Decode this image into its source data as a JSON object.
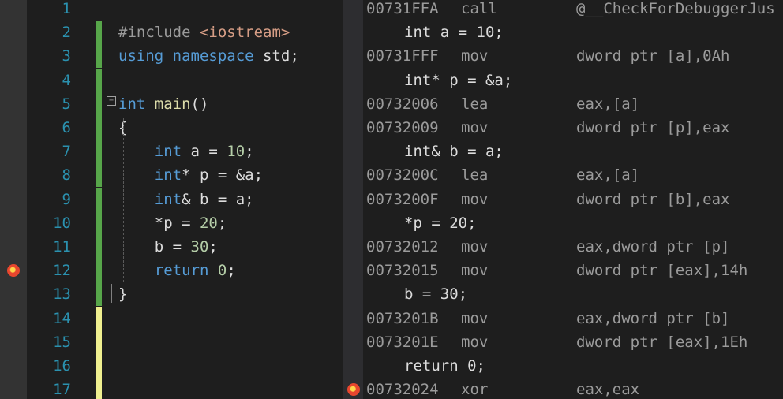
{
  "editor": {
    "lines": [
      {
        "n": "1",
        "tokens": []
      },
      {
        "n": "2",
        "tokens": [
          [
            "pp",
            "#include "
          ],
          [
            "str",
            "<iostream>"
          ]
        ]
      },
      {
        "n": "3",
        "tokens": [
          [
            "kw",
            "using"
          ],
          [
            "t",
            " "
          ],
          [
            "kw",
            "namespace"
          ],
          [
            "t",
            " std;"
          ]
        ]
      },
      {
        "n": "4",
        "tokens": []
      },
      {
        "n": "5",
        "tokens": [
          [
            "kw",
            "int"
          ],
          [
            "t",
            " "
          ],
          [
            "fn",
            "main"
          ],
          [
            "t",
            "()"
          ]
        ]
      },
      {
        "n": "6",
        "tokens": [
          [
            "t",
            "{"
          ]
        ]
      },
      {
        "n": "7",
        "tokens": [
          [
            "t",
            "    "
          ],
          [
            "kw",
            "int"
          ],
          [
            "t",
            " a = "
          ],
          [
            "num",
            "10"
          ],
          [
            "t",
            ";"
          ]
        ]
      },
      {
        "n": "8",
        "tokens": [
          [
            "t",
            "    "
          ],
          [
            "kw",
            "int"
          ],
          [
            "t",
            "* p = &a;"
          ]
        ]
      },
      {
        "n": "9",
        "tokens": [
          [
            "t",
            "    "
          ],
          [
            "kw",
            "int"
          ],
          [
            "t",
            "& b = a;"
          ]
        ]
      },
      {
        "n": "10",
        "tokens": [
          [
            "t",
            "    *p = "
          ],
          [
            "num",
            "20"
          ],
          [
            "t",
            ";"
          ]
        ]
      },
      {
        "n": "11",
        "tokens": [
          [
            "t",
            "    b = "
          ],
          [
            "num",
            "30"
          ],
          [
            "t",
            ";"
          ]
        ]
      },
      {
        "n": "12",
        "tokens": [
          [
            "t",
            "    "
          ],
          [
            "kw",
            "return"
          ],
          [
            "t",
            " "
          ],
          [
            "num",
            "0"
          ],
          [
            "t",
            ";"
          ]
        ]
      },
      {
        "n": "13",
        "tokens": [
          [
            "t",
            "}"
          ]
        ]
      },
      {
        "n": "14",
        "tokens": []
      },
      {
        "n": "15",
        "tokens": []
      },
      {
        "n": "16",
        "tokens": []
      },
      {
        "n": "17",
        "tokens": []
      }
    ],
    "breakpoint_line": "12",
    "collapse_glyph": "−"
  },
  "disassembly": {
    "rows": [
      {
        "addr": "00731FFA",
        "mnemonic": "call",
        "operands": "@__CheckForDebuggerJus"
      },
      {
        "src": "int a = 10;"
      },
      {
        "addr": "00731FFF",
        "mnemonic": "mov",
        "operands": "dword ptr [a],0Ah"
      },
      {
        "src": "int* p = &a;"
      },
      {
        "addr": "00732006",
        "mnemonic": "lea",
        "operands": "eax,[a]"
      },
      {
        "addr": "00732009",
        "mnemonic": "mov",
        "operands": "dword ptr [p],eax"
      },
      {
        "src": "int& b = a;"
      },
      {
        "addr": "0073200C",
        "mnemonic": "lea",
        "operands": "eax,[a]"
      },
      {
        "addr": "0073200F",
        "mnemonic": "mov",
        "operands": "dword ptr [b],eax"
      },
      {
        "src": "*p = 20;"
      },
      {
        "addr": "00732012",
        "mnemonic": "mov",
        "operands": "eax,dword ptr [p]"
      },
      {
        "addr": "00732015",
        "mnemonic": "mov",
        "operands": "dword ptr [eax],14h"
      },
      {
        "src": "b = 30;"
      },
      {
        "addr": "0073201B",
        "mnemonic": "mov",
        "operands": "eax,dword ptr [b]"
      },
      {
        "addr": "0073201E",
        "mnemonic": "mov",
        "operands": "dword ptr [eax],1Eh"
      },
      {
        "src": "return 0;"
      },
      {
        "addr": "00732024",
        "mnemonic": "xor",
        "operands": "eax,eax",
        "breakpoint": true
      }
    ]
  },
  "colors": {
    "keyword": "#569cd6",
    "type_name": "#4ec9b0",
    "string": "#d69d85",
    "preprocessor": "#9b9b9b",
    "number": "#b5cea8",
    "line_number": "#2b91af",
    "saved_change": "#57a64a",
    "unsaved_change": "#efef8f",
    "breakpoint": "#e8462e"
  }
}
